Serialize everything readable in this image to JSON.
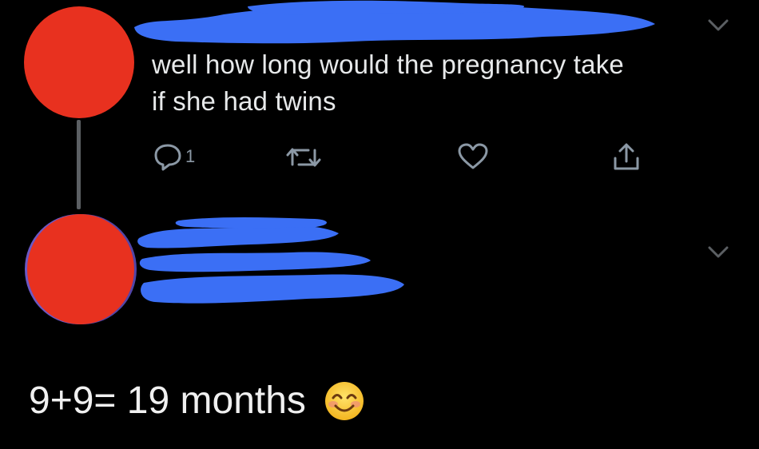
{
  "tweet": {
    "text_line1": "well how long would the pregnancy take",
    "text_line2": "if she had twins",
    "reply_count": "1",
    "icons": {
      "reply": "reply-icon",
      "retweet": "retweet-icon",
      "like": "heart-icon",
      "share": "share-icon",
      "menu": "chevron-down-icon"
    }
  },
  "reply": {
    "text": "9+9= 19 months",
    "emoji": "smiling-face-emoji"
  },
  "colors": {
    "background": "#000000",
    "text": "#e7e9ea",
    "icon": "#8b98a5",
    "redaction_blue": "#3b6ff5",
    "redaction_red": "#e8311f"
  }
}
